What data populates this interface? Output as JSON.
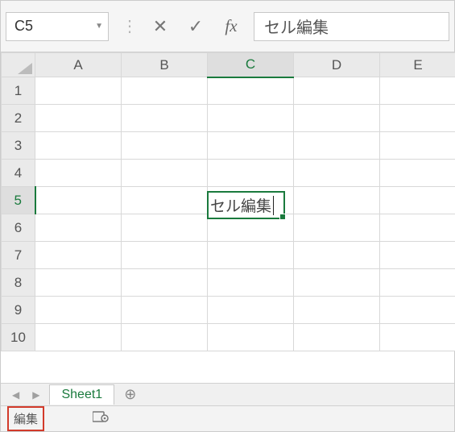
{
  "formula_bar": {
    "name_box_value": "C5",
    "cancel_icon": "✕",
    "confirm_icon": "✓",
    "fx_label": "fx",
    "input_value": "セル編集"
  },
  "grid": {
    "columns": [
      "A",
      "B",
      "C",
      "D",
      "E"
    ],
    "rows": [
      "1",
      "2",
      "3",
      "4",
      "5",
      "6",
      "7",
      "8",
      "9",
      "10"
    ],
    "active_column": "C",
    "active_row": "5",
    "active_cell_value": "セル編集"
  },
  "sheet_tabs": {
    "prev_nav": "◀",
    "next_nav": "▶",
    "tabs": [
      "Sheet1"
    ],
    "add_icon": "⊕"
  },
  "status_bar": {
    "mode": "編集"
  }
}
